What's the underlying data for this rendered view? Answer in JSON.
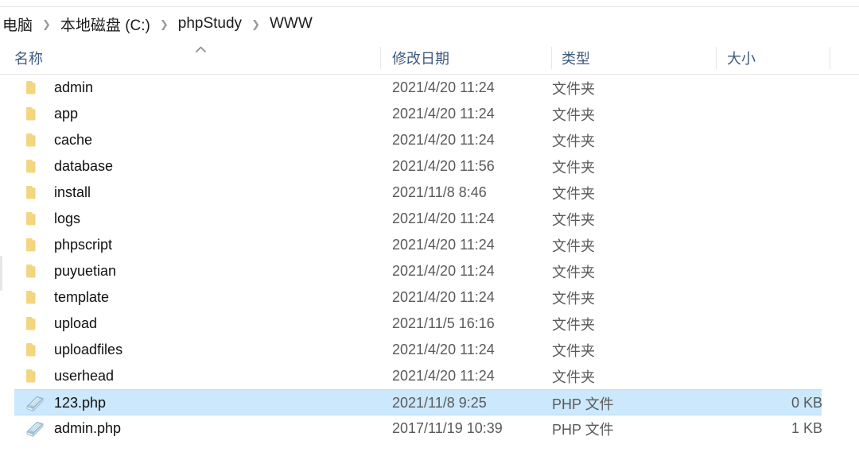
{
  "window": {
    "title": "WWW",
    "view": "details"
  },
  "breadcrumb": {
    "separator": "❯",
    "items": [
      {
        "label": "电脑"
      },
      {
        "label": "本地磁盘 (C:)"
      },
      {
        "label": "phpStudy"
      },
      {
        "label": "WWW"
      }
    ]
  },
  "columns": [
    {
      "key": "name",
      "label": "名称",
      "sorted": true,
      "sort_direction": "ascending",
      "sort_glyph": "caret-up"
    },
    {
      "key": "date",
      "label": "修改日期"
    },
    {
      "key": "type",
      "label": "类型"
    },
    {
      "key": "size",
      "label": "大小"
    }
  ],
  "colors": {
    "selection_fill": "#cce8fc",
    "selection_border": "#b9ddf7",
    "header_text": "#3d5a80",
    "folder_icon": "#f5d98b",
    "php_icon": "#a8cde4",
    "body_text": "#101010",
    "secondary_text": "#5a5a5a"
  },
  "rows": [
    {
      "name": "admin",
      "date": "2021/4/20 11:24",
      "type": "文件夹",
      "size": "",
      "icon": "folder-icon",
      "selected": false
    },
    {
      "name": "app",
      "date": "2021/4/20 11:24",
      "type": "文件夹",
      "size": "",
      "icon": "folder-icon",
      "selected": false
    },
    {
      "name": "cache",
      "date": "2021/4/20 11:24",
      "type": "文件夹",
      "size": "",
      "icon": "folder-icon",
      "selected": false
    },
    {
      "name": "database",
      "date": "2021/4/20 11:56",
      "type": "文件夹",
      "size": "",
      "icon": "folder-icon",
      "selected": false
    },
    {
      "name": "install",
      "date": "2021/11/8 8:46",
      "type": "文件夹",
      "size": "",
      "icon": "folder-icon",
      "selected": false
    },
    {
      "name": "logs",
      "date": "2021/4/20 11:24",
      "type": "文件夹",
      "size": "",
      "icon": "folder-icon",
      "selected": false
    },
    {
      "name": "phpscript",
      "date": "2021/4/20 11:24",
      "type": "文件夹",
      "size": "",
      "icon": "folder-icon",
      "selected": false
    },
    {
      "name": "puyuetian",
      "date": "2021/4/20 11:24",
      "type": "文件夹",
      "size": "",
      "icon": "folder-icon",
      "selected": false
    },
    {
      "name": "template",
      "date": "2021/4/20 11:24",
      "type": "文件夹",
      "size": "",
      "icon": "folder-icon",
      "selected": false
    },
    {
      "name": "upload",
      "date": "2021/11/5 16:16",
      "type": "文件夹",
      "size": "",
      "icon": "folder-icon",
      "selected": false
    },
    {
      "name": "uploadfiles",
      "date": "2021/4/20 11:24",
      "type": "文件夹",
      "size": "",
      "icon": "folder-icon",
      "selected": false
    },
    {
      "name": "userhead",
      "date": "2021/4/20 11:24",
      "type": "文件夹",
      "size": "",
      "icon": "folder-icon",
      "selected": false
    },
    {
      "name": "123.php",
      "date": "2021/11/8 9:25",
      "type": "PHP 文件",
      "size": "0 KB",
      "icon": "php-file-icon",
      "selected": true
    },
    {
      "name": "admin.php",
      "date": "2017/11/19 10:39",
      "type": "PHP 文件",
      "size": "1 KB",
      "icon": "php-file-icon",
      "selected": false
    }
  ]
}
